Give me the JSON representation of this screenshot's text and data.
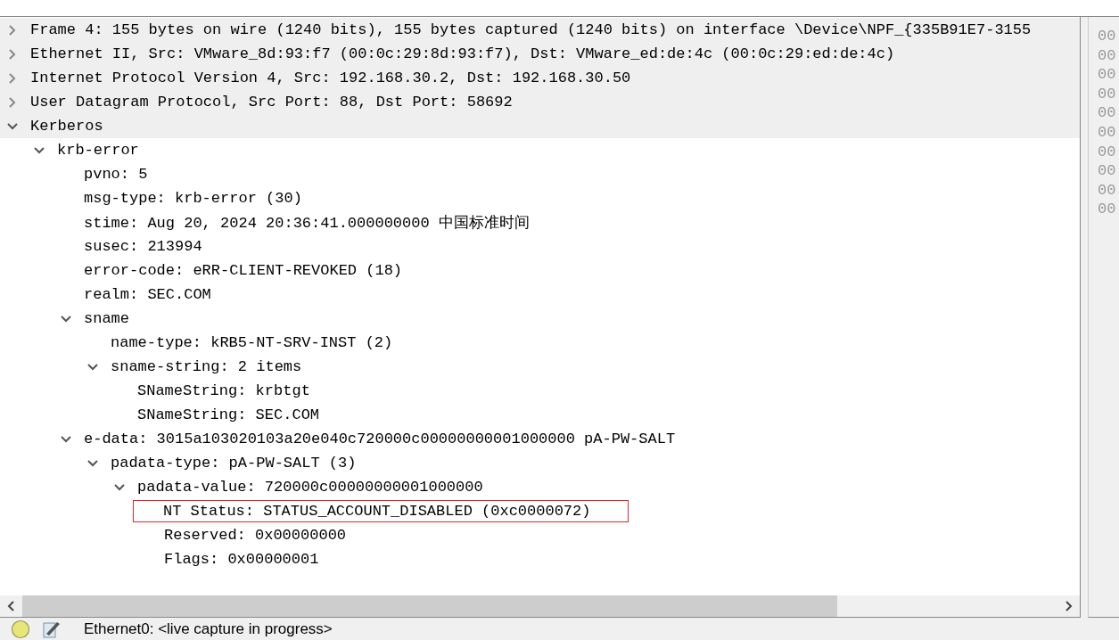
{
  "packet_details": [
    {
      "label": "Frame 4: 155 bytes on wire (1240 bits), 155 bytes captured (1240 bits) on interface \\Device\\NPF_{335B91E7-3155",
      "expanded": false
    },
    {
      "label": "Ethernet II, Src: VMware_8d:93:f7 (00:0c:29:8d:93:f7), Dst: VMware_ed:de:4c (00:0c:29:ed:de:4c)",
      "expanded": false
    },
    {
      "label": "Internet Protocol Version 4, Src: 192.168.30.2, Dst: 192.168.30.50",
      "expanded": false
    },
    {
      "label": "User Datagram Protocol, Src Port: 88, Dst Port: 58692",
      "expanded": false
    },
    {
      "label": "Kerberos",
      "expanded": true,
      "children": [
        {
          "label": "krb-error",
          "expanded": true,
          "children": [
            {
              "label": "pvno: 5"
            },
            {
              "label": "msg-type: krb-error (30)"
            },
            {
              "label": "stime: Aug 20, 2024 20:36:41.000000000 中国标准时间"
            },
            {
              "label": "susec: 213994"
            },
            {
              "label": "error-code: eRR-CLIENT-REVOKED (18)"
            },
            {
              "label": "realm: SEC.COM"
            },
            {
              "label": "sname",
              "expanded": true,
              "children": [
                {
                  "label": "name-type: kRB5-NT-SRV-INST (2)"
                },
                {
                  "label": "sname-string: 2 items",
                  "expanded": true,
                  "children": [
                    {
                      "label": "SNameString: krbtgt"
                    },
                    {
                      "label": "SNameString: SEC.COM"
                    }
                  ]
                }
              ]
            },
            {
              "label": "e-data: 3015a103020103a20e040c720000c00000000001000000 pA-PW-SALT",
              "expanded": true,
              "children": [
                {
                  "label": "padata-type: pA-PW-SALT (3)",
                  "expanded": true,
                  "children": [
                    {
                      "label": "padata-value: 720000c00000000001000000",
                      "expanded": true,
                      "children": [
                        {
                          "label": "NT Status: STATUS_ACCOUNT_DISABLED (0xc0000072)",
                          "highlighted": true
                        },
                        {
                          "label": "Reserved: 0x00000000",
                          "highlighted": false
                        },
                        {
                          "label": "Flags: 0x00000001",
                          "highlighted": false
                        }
                      ]
                    }
                  ]
                }
              ]
            }
          ]
        }
      ]
    }
  ],
  "packet_bytes_offsets": [
    "00",
    "00",
    "00",
    "00",
    "00",
    "00",
    "00",
    "00",
    "00",
    "00"
  ],
  "status_bar": {
    "text": "Ethernet0: <live capture in progress>"
  }
}
